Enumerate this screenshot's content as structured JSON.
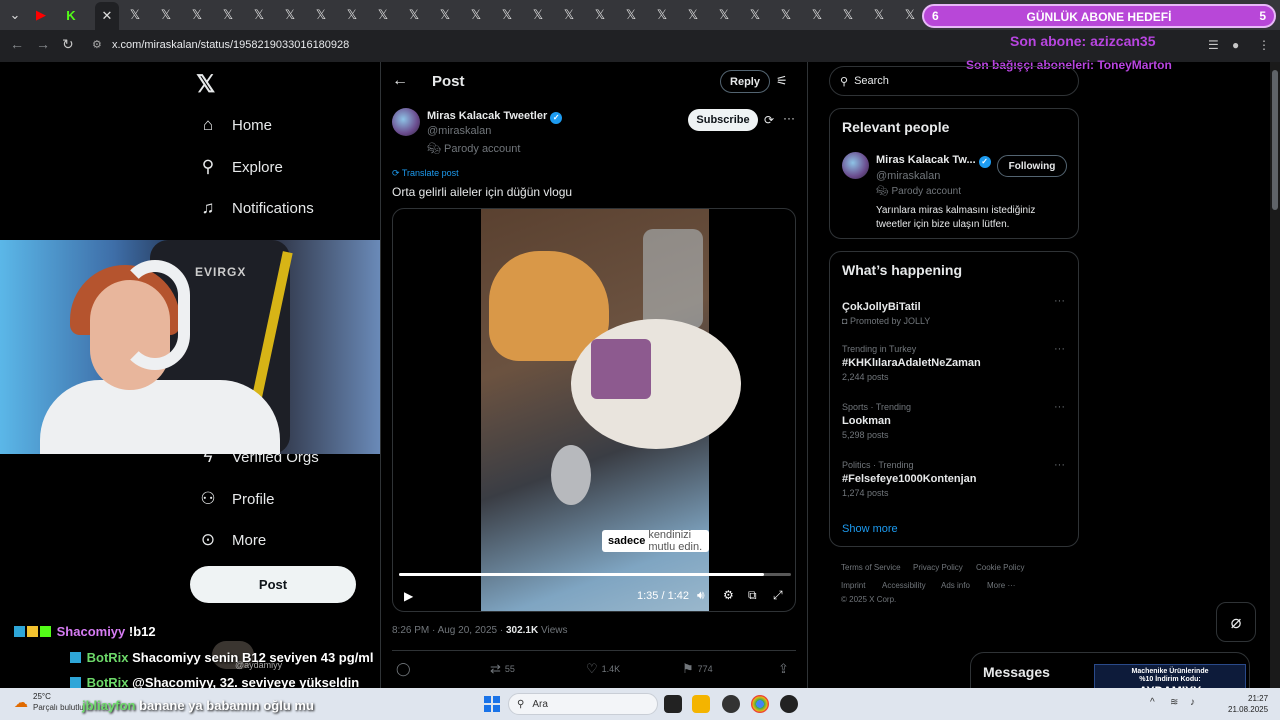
{
  "browser": {
    "url": "x.com/miraskalan/status/1958219033016180928",
    "tab_close": "✕",
    "tab_icon": "𝕏"
  },
  "overlay": {
    "goal_left": "6",
    "goal_title": "GÜNLÜK ABONE HEDEFİ",
    "goal_right": "5",
    "last_sub": "Son abone: azizcan35",
    "last_donor": "Son bağışçı aboneleri: ToneyMarton"
  },
  "nav": {
    "logo": "𝕏",
    "items": [
      {
        "label": "Home",
        "icon": "home-icon"
      },
      {
        "label": "Explore",
        "icon": "search-icon"
      },
      {
        "label": "Notifications",
        "icon": "bell-icon"
      },
      {
        "label": "Verified Orgs",
        "icon": "lightning-icon"
      },
      {
        "label": "Profile",
        "icon": "person-icon"
      },
      {
        "label": "More",
        "icon": "more-circle-icon"
      }
    ],
    "post_button": "Post"
  },
  "chat": [
    {
      "nick": "Shacomiyy",
      "text": "!b12"
    },
    {
      "nick": "BotRix",
      "text": "Shacomiyy senin B12 seviyen 43 pg/ml"
    },
    {
      "nick": "BotRix",
      "text": "@Shacomiyy, 32. seviyeye yükseldin"
    },
    {
      "nick": "jbliayfon",
      "text": "banane ya babamın oğlu mu"
    }
  ],
  "chat_handle": "@aydamiyy",
  "post_header": {
    "title": "Post",
    "reply_button": "Reply"
  },
  "tweet": {
    "author_name": "Miras Kalacak Tweetler",
    "author_handle": "@miraskalan",
    "account_label": "Parody account",
    "subscribe_button": "Subscribe",
    "translate": "Translate post",
    "text": "Orta gelirli aileler için düğün vlogu",
    "caption_bold": "sadece",
    "caption_rest": "kendinizi mutlu edin.",
    "video_time": "1:35 / 1:42",
    "progress_fraction": 0.93,
    "timestamp": "8:26 PM · Aug 20, 2025 · ",
    "views_count": "302.1K",
    "views_label": " Views",
    "retweets": "55",
    "likes": "1.4K",
    "bookmarks": "774"
  },
  "search": {
    "placeholder": "Search"
  },
  "relevant": {
    "title": "Relevant people",
    "name": "Miras Kalacak Tw...",
    "handle": "@miraskalan",
    "label": "Parody account",
    "bio": "Yarınlara miras kalmasını istediğiniz tweetler için bize ulaşın lütfen.",
    "button": "Following"
  },
  "happening": {
    "title": "What’s happening",
    "trends": [
      {
        "context": "",
        "name": "ÇokJollyBiTatil",
        "posts": "Promoted by JOLLY"
      },
      {
        "context": "Trending in Turkey",
        "name": "#KHKlılaraAdaletNeZaman",
        "posts": "2,244 posts"
      },
      {
        "context": "Sports · Trending",
        "name": "Lookman",
        "posts": "5,298 posts"
      },
      {
        "context": "Politics · Trending",
        "name": "#Felsefeye1000Kontenjan",
        "posts": "1,274 posts"
      }
    ],
    "show_more": "Show more"
  },
  "footer": {
    "links": [
      "Terms of Service",
      "Privacy Policy",
      "Cookie Policy",
      "Imprint",
      "Accessibility",
      "Ads info",
      "More ···"
    ],
    "copyright": "© 2025 X Corp."
  },
  "messages": {
    "title": "Messages"
  },
  "ad": {
    "line1": "Machenike Ürünlerinde",
    "line2": "%10 İndirim Kodu:",
    "brand": "AYDAMIYY"
  },
  "taskbar": {
    "temp": "25°C",
    "weather": "Parçalı bulutlu",
    "search": "Ara",
    "time": "21:27",
    "date": "21.08.2025"
  }
}
